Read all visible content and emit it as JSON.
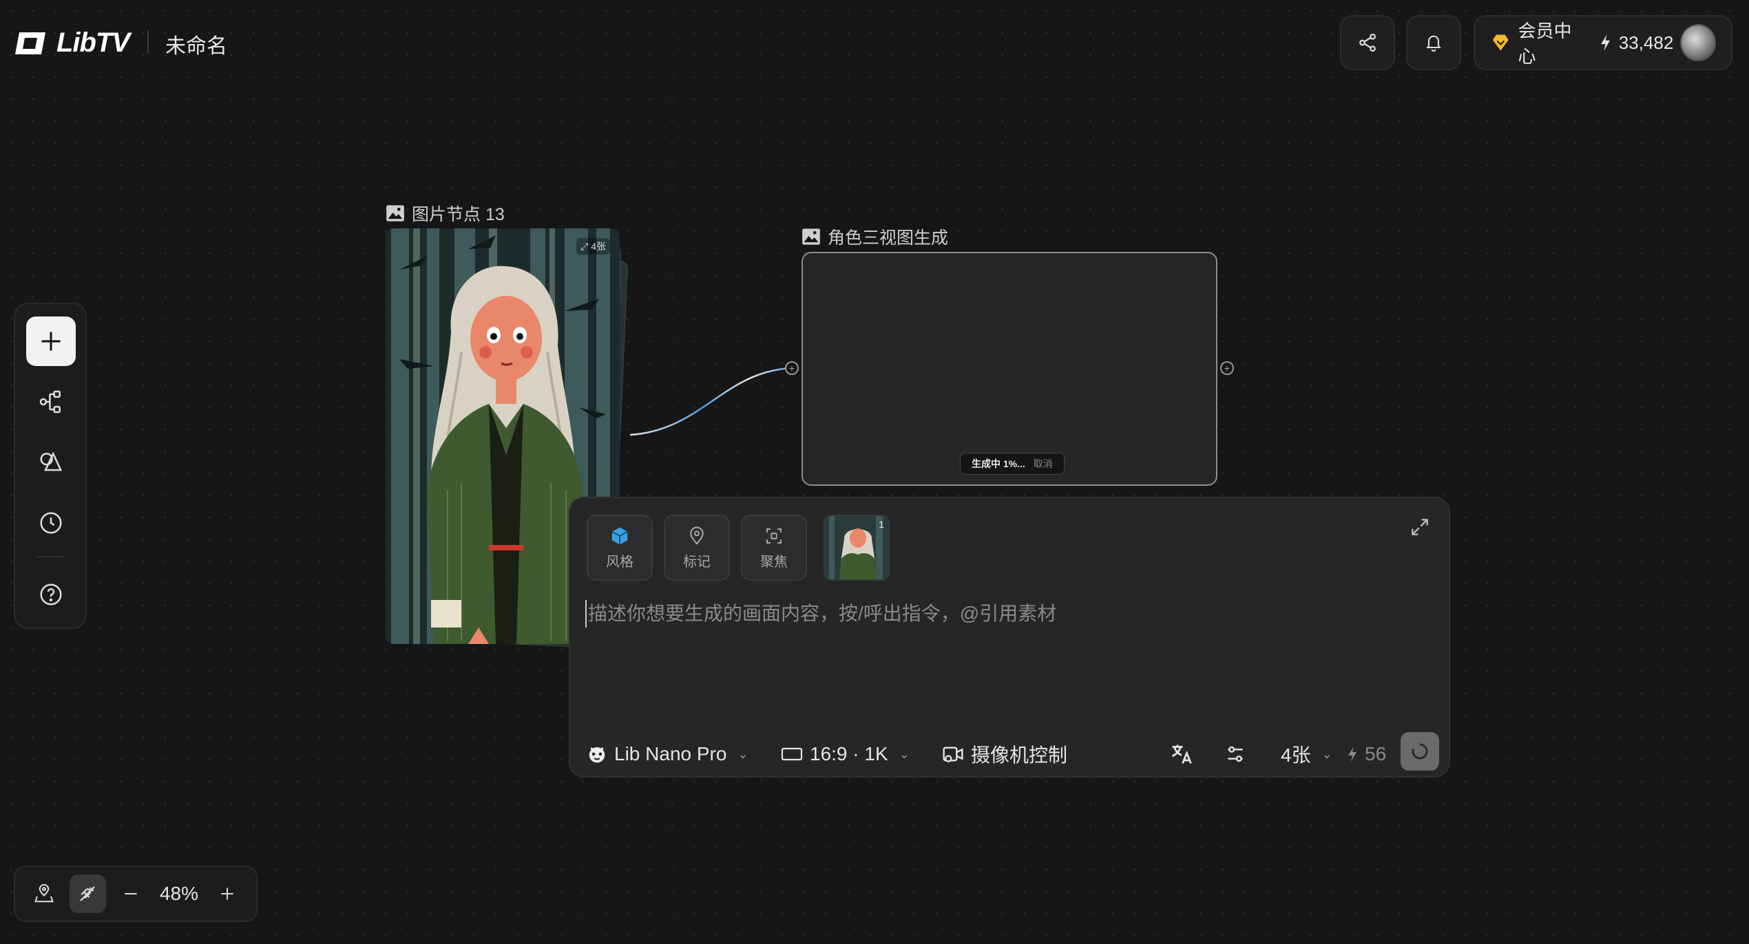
{
  "header": {
    "logo_text": "LibTV",
    "project_title": "未命名",
    "member_label": "会员中心",
    "credits": "33,482"
  },
  "canvas": {
    "image_node": {
      "label": "图片节点 13",
      "count_badge": "4张"
    },
    "gen_node": {
      "label": "角色三视图生成",
      "status": "生成中 1%...",
      "cancel": "取消"
    }
  },
  "prompt": {
    "chips": [
      {
        "label": "风格",
        "icon": "cube-icon"
      },
      {
        "label": "标记",
        "icon": "pin-icon"
      },
      {
        "label": "聚焦",
        "icon": "focus-icon"
      }
    ],
    "thumb_index": "1",
    "placeholder": "描述你想要生成的画面内容，按/呼出指令，@引用素材",
    "model": "Lib Nano Pro",
    "ratio": "16:9 · 1K",
    "camera": "摄像机控制",
    "count": "4张",
    "cost": "56"
  },
  "zoom": {
    "value": "48%"
  },
  "colors": {
    "background": "#161616",
    "accent_gold": "#f5b82e",
    "port_line": "#4aa0e6"
  }
}
